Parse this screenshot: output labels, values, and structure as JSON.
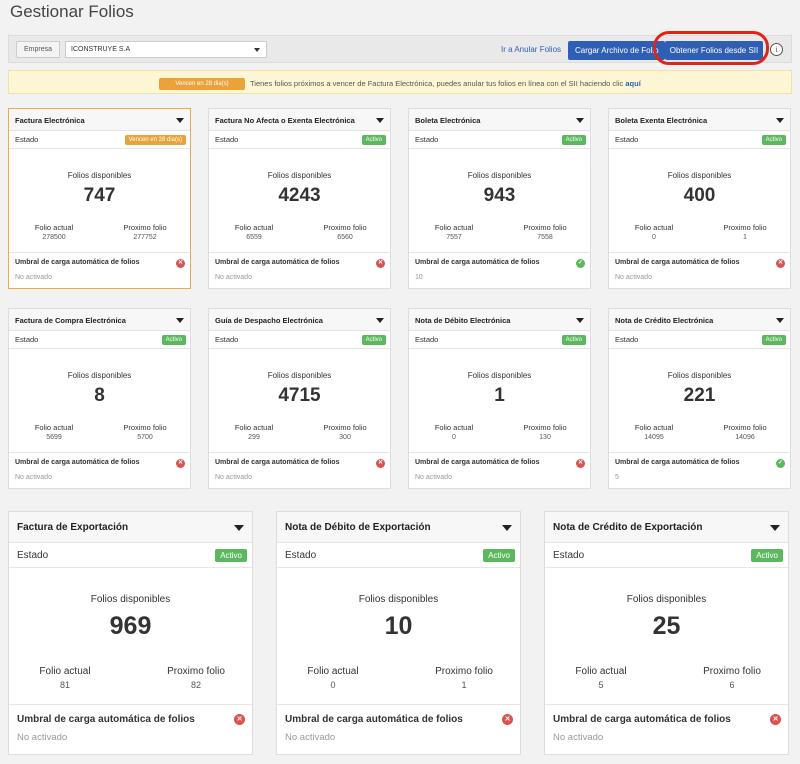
{
  "page": {
    "title": "Gestionar Folios"
  },
  "toolbar": {
    "company_label": "Empresa",
    "company_value": "ICONSTRUYE S.A",
    "anular_link": "Ir a Anular Folios",
    "cargar_button": "Cargar Archivo de Folio",
    "obtener_button": "Obtener Folios desde SII",
    "info_icon": "i"
  },
  "alert": {
    "badge": "Vencen en 28 dia(s)",
    "text": "Tienes folios próximos a vencer de Factura Electrónica, puedes anular tus folios en línea con el SII haciendo clic",
    "link": "aquí",
    "badge_color": "#e9a33a",
    "background": "#fdf6d5"
  },
  "labels": {
    "estado": "Estado",
    "folios_disponibles": "Folios disponibles",
    "folio_actual": "Folio actual",
    "proximo_folio": "Proximo folio",
    "umbral": "Umbral de carga automática de folios"
  },
  "cards": [
    {
      "title": "Factura Electrónica",
      "badge": "Vencen en 28 dia(s)",
      "badge_type": "warn",
      "disponibles": "747",
      "actual": "278500",
      "proximo": "277752",
      "umbral_icon": "close-icon",
      "umbral_value": "No activado"
    },
    {
      "title": "Factura No Afecta o Exenta Electrónica",
      "badge": "Activo",
      "badge_type": "ok",
      "disponibles": "4243",
      "actual": "6559",
      "proximo": "6560",
      "umbral_icon": "close-icon",
      "umbral_value": "No activado"
    },
    {
      "title": "Boleta Electrónica",
      "badge": "Activo",
      "badge_type": "ok",
      "disponibles": "943",
      "actual": "7557",
      "proximo": "7558",
      "umbral_icon": "check-icon",
      "umbral_value": "10"
    },
    {
      "title": "Boleta Exenta Electrónica",
      "badge": "Activo",
      "badge_type": "ok",
      "disponibles": "400",
      "actual": "0",
      "proximo": "1",
      "umbral_icon": "close-icon",
      "umbral_value": "No activado"
    },
    {
      "title": "Factura de Compra Electrónica",
      "badge": "Activo",
      "badge_type": "ok",
      "disponibles": "8",
      "actual": "5699",
      "proximo": "5700",
      "umbral_icon": "close-icon",
      "umbral_value": "No activado"
    },
    {
      "title": "Guía de Despacho Electrónica",
      "badge": "Activo",
      "badge_type": "ok",
      "disponibles": "4715",
      "actual": "299",
      "proximo": "300",
      "umbral_icon": "close-icon",
      "umbral_value": "No activado"
    },
    {
      "title": "Nota de Débito Electrónica",
      "badge": "Activo",
      "badge_type": "ok",
      "disponibles": "1",
      "actual": "0",
      "proximo": "130",
      "umbral_icon": "close-icon",
      "umbral_value": "No activado"
    },
    {
      "title": "Nota de Crédito Electrónica",
      "badge": "Activo",
      "badge_type": "ok",
      "disponibles": "221",
      "actual": "14095",
      "proximo": "14096",
      "umbral_icon": "check-icon",
      "umbral_value": "5"
    },
    {
      "title": "Factura de Exportación",
      "badge": "Activo",
      "badge_type": "ok",
      "disponibles": "969",
      "actual": "81",
      "proximo": "82",
      "umbral_icon": "close-icon",
      "umbral_value": "No activado"
    },
    {
      "title": "Nota de Débito de Exportación",
      "badge": "Activo",
      "badge_type": "ok",
      "disponibles": "10",
      "actual": "0",
      "proximo": "1",
      "umbral_icon": "close-icon",
      "umbral_value": "No activado"
    },
    {
      "title": "Nota de Crédito de Exportación",
      "badge": "Activo",
      "badge_type": "ok",
      "disponibles": "25",
      "actual": "5",
      "proximo": "6",
      "umbral_icon": "close-icon",
      "umbral_value": "No activado"
    }
  ],
  "colors": {
    "primary": "#2f5fb5",
    "active": "#5cb85c",
    "warning": "#e9a33a",
    "error": "#d9534f",
    "highlight": "#e02418"
  }
}
